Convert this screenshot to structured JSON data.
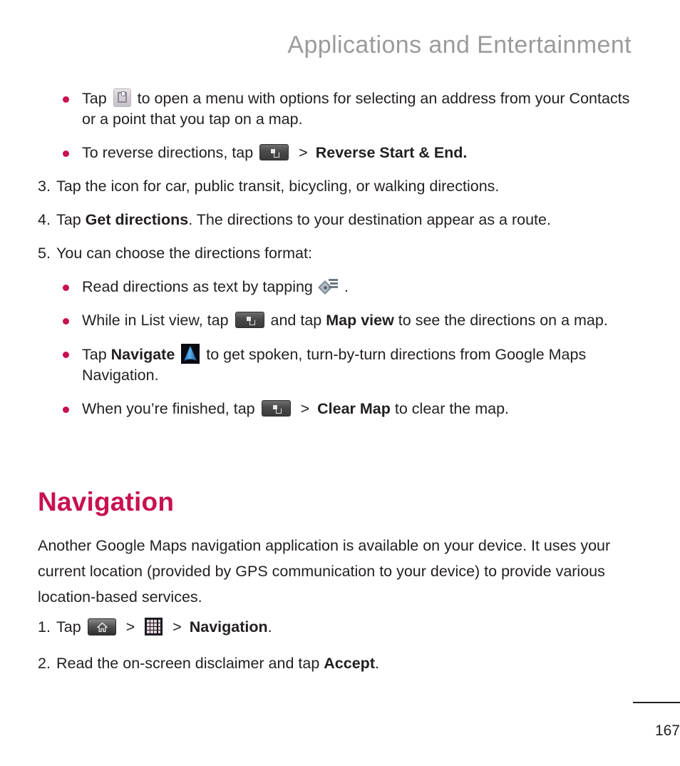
{
  "header": {
    "chapter_title": "Applications and Entertainment"
  },
  "colors": {
    "accent": "#C8114F",
    "header_gray": "#9B9B9B",
    "body_text": "#231F20"
  },
  "top_bullets": [
    {
      "icon": "contacts-icon",
      "text_before": "Tap",
      "text_after": "to open a menu with options for selecting an address from your Contacts or a point that you tap on a map."
    },
    {
      "icon": "menu-key-icon",
      "text_before": "To reverse directions, tap",
      "separator": ">",
      "bold_after": "Reverse Start & End."
    }
  ],
  "steps": [
    {
      "number": "3.",
      "text": "Tap the icon for car, public transit, bicycling, or walking directions."
    },
    {
      "number": "4.",
      "text_before": "Tap",
      "bold": "Get directions",
      "text_after": ". The directions to your destination appear as a route."
    },
    {
      "number": "5.",
      "text": "You can choose the directions format:"
    }
  ],
  "format_bullets": [
    {
      "icon": "directions-list-icon",
      "text_before": "Read directions as text by tapping",
      "text_after": "."
    },
    {
      "icon": "menu-key-icon",
      "text_before": "While in List view, tap",
      "text_mid": "and tap",
      "bold": "Map view",
      "text_after": "to see the directions on a map."
    },
    {
      "icon": "navigate-icon",
      "text_before": "Tap",
      "bold": "Navigate",
      "text_after": "to get spoken, turn-by-turn directions from Google Maps Navigation."
    },
    {
      "icon": "menu-key-icon",
      "text_before": "When you’re finished, tap",
      "separator": ">",
      "bold": "Clear Map",
      "text_after": "to clear the map."
    }
  ],
  "section": {
    "heading": "Navigation",
    "paragraph": "Another Google Maps navigation application is available on your device. It uses your current location (provided by GPS communication to your device) to provide various location-based services."
  },
  "tail_steps": [
    {
      "number": "1.",
      "text_before": "Tap",
      "separator1": ">",
      "separator2": ">",
      "bold": "Navigation",
      "text_after": "."
    },
    {
      "number": "2.",
      "text_before": "Read the on-screen disclaimer and tap",
      "bold": "Accept",
      "text_after": "."
    }
  ],
  "footer": {
    "page_number": "167"
  }
}
